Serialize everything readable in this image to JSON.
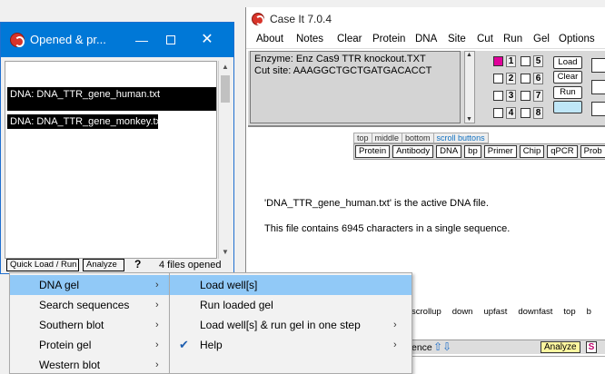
{
  "left_window": {
    "title": "Opened & pr...",
    "files": [
      "DNA: DNA_TTR_gene_human.txt",
      "DNA: DNA_TTR_gene_monkey.txt"
    ],
    "quick_load_label": "Quick Load / Run",
    "analyze_label": "Analyze",
    "help_label": "?",
    "files_count": "4  files opened"
  },
  "right_window": {
    "title": "Case It 7.0.4",
    "menu": [
      "About",
      "Notes",
      "Clear",
      "Protein",
      "DNA",
      "Site",
      "Cut",
      "Run",
      "Gel",
      "Options"
    ],
    "enzyme_line": "Enzyme: Enz Cas9 TTR knockout.TXT",
    "cut_site_line": "Cut site: AAAGGCTGCTGATGACACCT",
    "lanes": [
      "1",
      "2",
      "3",
      "4",
      "5",
      "6",
      "7",
      "8"
    ],
    "load_label": "Load",
    "clear_label": "Clear",
    "run_label": "Run",
    "tabs": [
      "top",
      "middle",
      "bottom",
      "scroll buttons"
    ],
    "tools": [
      "Protein",
      "Antibody",
      "DNA",
      "bp",
      "Primer",
      "Chip",
      "qPCR",
      "Prob"
    ],
    "message_1": "'DNA_TTR_gene_human.txt' is the active DNA file.",
    "message_2": "This file contains 6945 characters in a single sequence.",
    "scroll_buttons": [
      "scrollup",
      "down",
      "upfast",
      "downfast",
      "top",
      "b"
    ],
    "bottom_label": "ence",
    "analyze_label": "Analyze",
    "s_label": "S"
  },
  "menu_primary": {
    "items": [
      "DNA gel",
      "Search sequences",
      "Southern blot",
      "Protein gel",
      "Western blot"
    ],
    "highlighted_index": 0
  },
  "menu_secondary": {
    "items": [
      "Load  well[s]",
      "Run loaded gel",
      "Load well[s] & run gel in one step",
      "Help"
    ],
    "highlighted_index": 0,
    "checked_item": "Help"
  },
  "colors": {
    "titlebar_active": "#0078d7",
    "menu_highlight": "#91c9f7",
    "lane_selected": "#e0009a"
  }
}
